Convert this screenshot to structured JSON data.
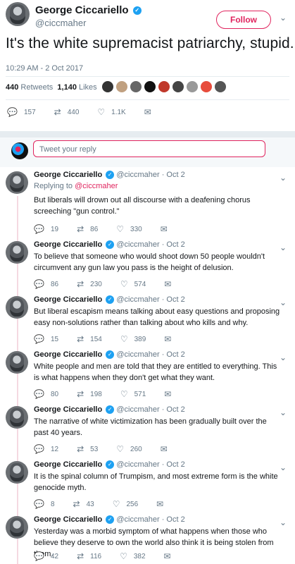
{
  "main": {
    "name": "George Ciccariello",
    "handle": "@ciccmaher",
    "follow_label": "Follow",
    "text": "It's the white supremacist patriarchy, stupid.",
    "timestamp": "10:29 AM - 2 Oct 2017",
    "retweets_count": "440",
    "retweets_label": "Retweets",
    "likes_count": "1,140",
    "likes_label": "Likes",
    "replies": "157",
    "retweets": "440",
    "likes": "1.1K"
  },
  "reply_box": {
    "placeholder": "Tweet your reply"
  },
  "replies": [
    {
      "name": "George Ciccariello",
      "handle": "@ciccmaher",
      "date": "Oct 2",
      "replying_prefix": "Replying to",
      "replying_to": "@ciccmaher",
      "text": "But liberals will drown out all discourse with a deafening chorus screeching \"gun control.\"",
      "replies": "19",
      "retweets": "86",
      "likes": "330"
    },
    {
      "name": "George Ciccariello",
      "handle": "@ciccmaher",
      "date": "Oct 2",
      "text": "To believe that someone who would shoot down 50 people wouldn't circumvent any gun law you pass is the height of delusion.",
      "replies": "86",
      "retweets": "230",
      "likes": "574"
    },
    {
      "name": "George Ciccariello",
      "handle": "@ciccmaher",
      "date": "Oct 2",
      "text": "But liberal escapism means talking about easy questions and proposing easy non-solutions rather than talking about who kills and why.",
      "replies": "15",
      "retweets": "154",
      "likes": "389"
    },
    {
      "name": "George Ciccariello",
      "handle": "@ciccmaher",
      "date": "Oct 2",
      "text": "White people and men are told that they are entitled to everything. This is what happens when they don't get what they want.",
      "replies": "80",
      "retweets": "198",
      "likes": "571"
    },
    {
      "name": "George Ciccariello",
      "handle": "@ciccmaher",
      "date": "Oct 2",
      "text": "The narrative of white victimization has been gradually built over the past 40 years.",
      "replies": "12",
      "retweets": "53",
      "likes": "260"
    },
    {
      "name": "George Ciccariello",
      "handle": "@ciccmaher",
      "date": "Oct 2",
      "text": "It is the spinal column of Trumpism, and most extreme form is the white genocide myth.",
      "replies": "8",
      "retweets": "43",
      "likes": "256"
    },
    {
      "name": "George Ciccariello",
      "handle": "@ciccmaher",
      "date": "Oct 2",
      "text": "Yesterday was a morbid symptom of what happens when those who believe they deserve to own the world also think it is being stolen from them.",
      "replies": "42",
      "retweets": "116",
      "likes": "382"
    }
  ],
  "icons": {
    "verified": "verified-badge-icon",
    "chevron": "chevron-down-icon",
    "reply": "reply-icon",
    "retweet": "retweet-icon",
    "like": "heart-icon",
    "dm": "envelope-icon"
  },
  "colors": {
    "accent": "#e0245e",
    "verified": "#1da1f2",
    "muted": "#657786",
    "text": "#14171a"
  }
}
